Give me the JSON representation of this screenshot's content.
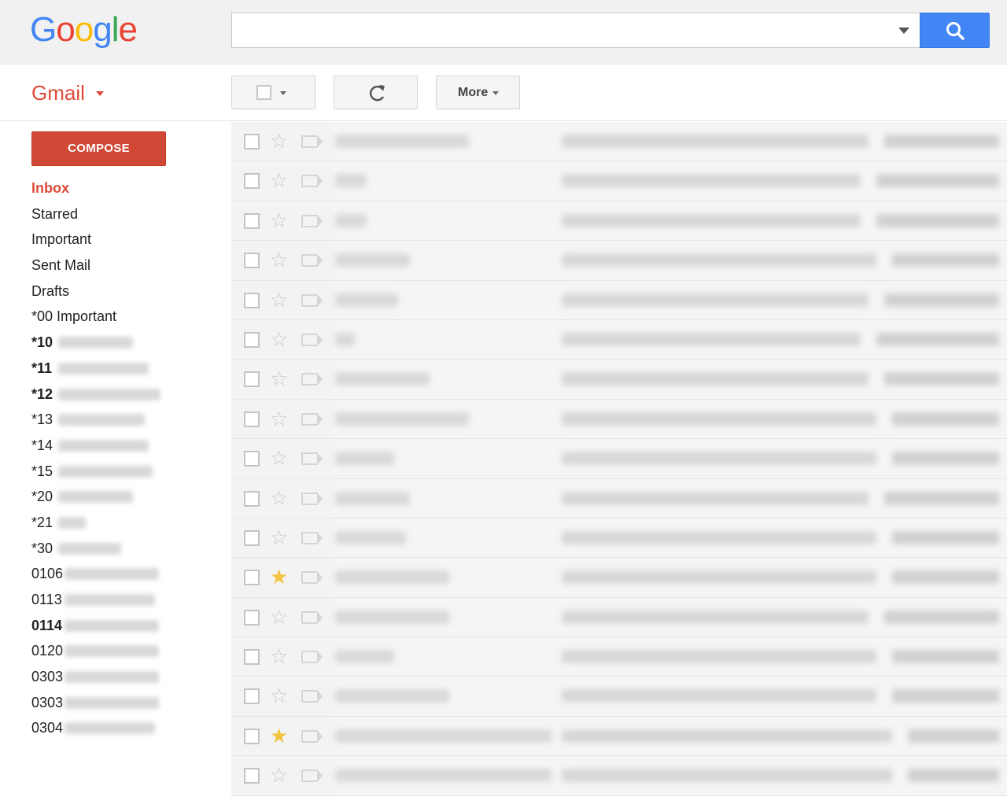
{
  "header": {
    "logo_letters": [
      {
        "ch": "G",
        "color": "#4285f4"
      },
      {
        "ch": "o",
        "color": "#ea4335"
      },
      {
        "ch": "o",
        "color": "#fbbc05"
      },
      {
        "ch": "g",
        "color": "#4285f4"
      },
      {
        "ch": "l",
        "color": "#34a853"
      },
      {
        "ch": "e",
        "color": "#ea4335"
      }
    ],
    "search": {
      "value": "",
      "placeholder": ""
    },
    "search_button_icon": "search-icon"
  },
  "subheader": {
    "app_label": "Gmail",
    "toolbar": {
      "select_icon": "checkbox-icon",
      "refresh_icon": "refresh-icon",
      "more_label": "More"
    }
  },
  "sidebar": {
    "compose_label": "COMPOSE",
    "items": [
      {
        "label": "Inbox",
        "style": "inbox"
      },
      {
        "label": "Starred",
        "style": ""
      },
      {
        "label": "Important",
        "style": ""
      },
      {
        "label": "Sent Mail",
        "style": ""
      },
      {
        "label": "Drafts",
        "style": ""
      },
      {
        "label": "*00 Important",
        "style": ""
      },
      {
        "label": "*10",
        "style": "bold"
      },
      {
        "label": "*11",
        "style": "bold"
      },
      {
        "label": "*12",
        "style": "bold"
      },
      {
        "label": "*13",
        "style": ""
      },
      {
        "label": "*14",
        "style": ""
      },
      {
        "label": "*15",
        "style": ""
      },
      {
        "label": "*20",
        "style": ""
      },
      {
        "label": "*21",
        "style": ""
      },
      {
        "label": "*30",
        "style": ""
      },
      {
        "label": "0106",
        "style": ""
      },
      {
        "label": "0113",
        "style": ""
      },
      {
        "label": "0114",
        "style": "bold"
      },
      {
        "label": "0120",
        "style": ""
      },
      {
        "label": "0303",
        "style": ""
      },
      {
        "label": "0303",
        "style": ""
      },
      {
        "label": "0304",
        "style": ""
      }
    ]
  },
  "mail_list": {
    "rows": [
      {
        "starred": false
      },
      {
        "starred": false
      },
      {
        "starred": false
      },
      {
        "starred": false
      },
      {
        "starred": false
      },
      {
        "starred": false
      },
      {
        "starred": false
      },
      {
        "starred": false
      },
      {
        "starred": false
      },
      {
        "starred": false
      },
      {
        "starred": false
      },
      {
        "starred": true
      },
      {
        "starred": false
      },
      {
        "starred": false
      },
      {
        "starred": false
      },
      {
        "starred": true
      },
      {
        "starred": false
      }
    ]
  },
  "colors": {
    "gmail_red": "#dd4b39",
    "compose_bg": "#d14836",
    "search_blue": "#4285f4",
    "star_on": "#f4c441"
  }
}
